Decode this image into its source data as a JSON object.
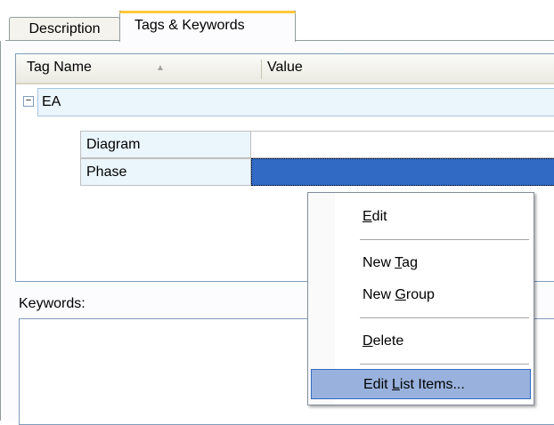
{
  "tabs": {
    "description_label": "Description",
    "tags_label": "Tags & Keywords"
  },
  "grid": {
    "col_name": "Tag Name",
    "col_value": "Value",
    "sort_indicator": "▲",
    "group_label": "EA",
    "expander": "−",
    "rows": [
      {
        "name": "Diagram",
        "value": ""
      },
      {
        "name": "Phase",
        "value": "",
        "selected": true
      }
    ]
  },
  "keywords": {
    "label": "Keywords:",
    "value": ""
  },
  "context_menu": {
    "items": [
      {
        "prefix": "",
        "accel": "E",
        "suffix": "dit"
      },
      {
        "prefix": "New ",
        "accel": "T",
        "suffix": "ag"
      },
      {
        "prefix": "New ",
        "accel": "G",
        "suffix": "roup"
      },
      {
        "prefix": "",
        "accel": "D",
        "suffix": "elete"
      },
      {
        "prefix": "Edit ",
        "accel": "L",
        "suffix": "ist Items...",
        "highlighted": true
      }
    ]
  },
  "colors": {
    "selection": "#316ac5",
    "menu_highlight": "#99b2dd",
    "active_tab_accent": "#ffc83c"
  }
}
